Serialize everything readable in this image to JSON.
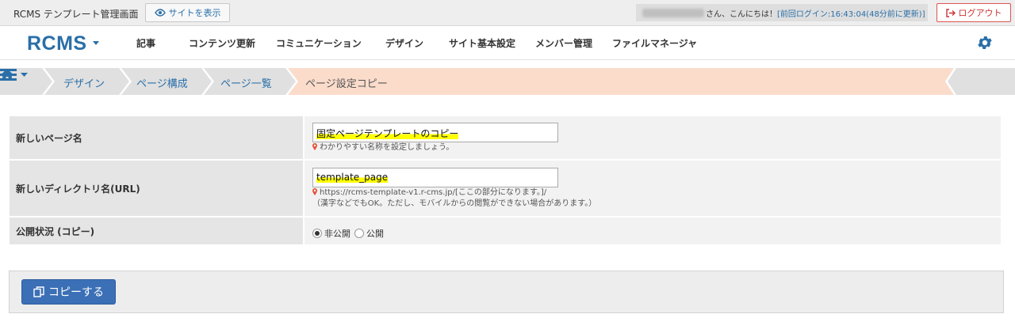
{
  "topbar": {
    "app_title": "RCMS テンプレート管理画面",
    "view_site_label": "サイトを表示",
    "greeting_suffix": "さん、こんにちは！",
    "last_login": "[前回ログイン:16:43:04(48分前に更新)]",
    "logout_label": "ログアウト"
  },
  "nav": {
    "logo": "RCMS",
    "items": [
      "記事",
      "コンテンツ更新",
      "コミュニケーション",
      "デザイン",
      "サイト基本設定",
      "メンバー管理",
      "ファイルマネージャ"
    ]
  },
  "breadcrumb": {
    "items": [
      "デザイン",
      "ページ構成",
      "ページ一覧"
    ],
    "current": "ページ設定コピー"
  },
  "form": {
    "page_name": {
      "label": "新しいページ名",
      "value": "固定ページテンプレートのコピー",
      "hint": "わかりやすい名称を設定しましょう。"
    },
    "directory": {
      "label": "新しいディレクトリ名(URL)",
      "value": "template_page",
      "hint_url": "https://rcms-template-v1.r-cms.jp/[ここの部分になります。]/",
      "hint_note": "（漢字などでもOK。ただし、モバイルからの閲覧ができない場合があります。）"
    },
    "status": {
      "label": "公開状況 (コピー)",
      "options": [
        "非公開",
        "公開"
      ],
      "selected": "非公開"
    }
  },
  "actions": {
    "copy_label": "コピーする"
  },
  "colors": {
    "accent": "#2a6fa8",
    "breadcrumb_current_bg": "#fbdccb",
    "breadcrumb_bg": "#e0e0e0",
    "button_bg": "#3b6fb6",
    "highlight": "#ffff00"
  },
  "icons": [
    "eye-icon",
    "logout-icon",
    "gear-icon",
    "home-icon",
    "hamburger-menu-icon",
    "copy-icon",
    "pin-icon"
  ]
}
